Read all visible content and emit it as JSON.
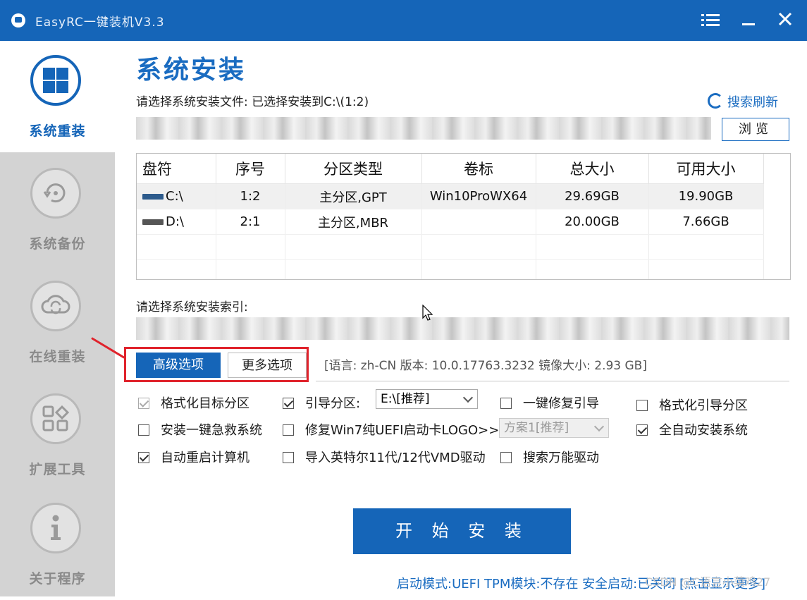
{
  "window": {
    "title": "EasyRC一键装机V3.3"
  },
  "sidebar": {
    "items": [
      {
        "label": "系统重装",
        "icon": "windows-icon",
        "active": true
      },
      {
        "label": "系统备份",
        "icon": "backup-icon",
        "active": false
      },
      {
        "label": "在线重装",
        "icon": "cloud-sync-icon",
        "active": false
      },
      {
        "label": "扩展工具",
        "icon": "tools-grid-icon",
        "active": false
      },
      {
        "label": "关于程序",
        "icon": "info-icon",
        "active": false
      }
    ]
  },
  "main": {
    "heading": "系统安装",
    "file_label": "请选择系统安装文件: 已选择安装到C:\\(1:2)",
    "refresh_label": "搜索刷新",
    "browse_label": "浏览",
    "table": {
      "headers": [
        "盘符",
        "序号",
        "分区类型",
        "卷标",
        "总大小",
        "可用大小"
      ],
      "rows": [
        {
          "drive": "C:\\",
          "index": "1:2",
          "type": "主分区,GPT",
          "volume": "Win10ProWX64",
          "total": "29.69GB",
          "free": "19.90GB"
        },
        {
          "drive": "D:\\",
          "index": "2:1",
          "type": "主分区,MBR",
          "volume": "",
          "total": "20.00GB",
          "free": "7.66GB"
        }
      ]
    },
    "index_label": "请选择系统安装索引:",
    "tabs": {
      "advanced": "高级选项",
      "more": "更多选项"
    },
    "info_text": "[语言: zh-CN 版本: 10.0.17763.3232 镜像大小: 2.93 GB]",
    "options": {
      "format_target": "格式化目标分区",
      "boot_partition": "引导分区:",
      "boot_partition_value": "E:\\[推荐]",
      "repair_boot": "一键修复引导",
      "format_boot": "格式化引导分区",
      "install_rescue": "安装一键急救系统",
      "repair_win7": "修复Win7纯UEFI启动卡LOGO>>",
      "scheme_value": "方案1[推荐]",
      "auto_install": "全自动安装系统",
      "auto_reboot": "自动重启计算机",
      "import_intel": "导入英特尔11代/12代VMD驱动",
      "search_driver": "搜索万能驱动"
    },
    "start_button": "开 始 安 装",
    "status": "启动模式:UEFI TPM模块:不存在 安全启动:已关闭 [点击显示更多]",
    "watermark": "CSDN @C语言小菜鸡27"
  },
  "colors": {
    "primary": "#1565b8",
    "highlight_box": "#e0232c",
    "sidebar_bg": "#d3d3d3"
  }
}
